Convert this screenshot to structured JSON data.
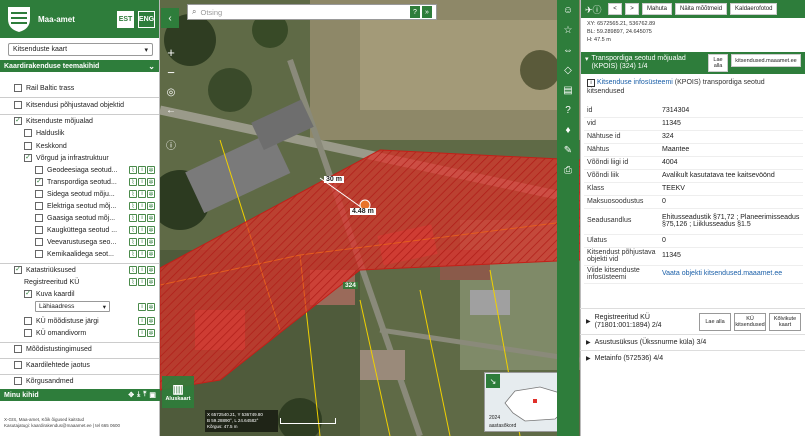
{
  "brand": {
    "name": "Maa-amet",
    "lang_est": "EST",
    "lang_eng": "ENG"
  },
  "map_select": {
    "value": "Kitsenduste kaart"
  },
  "theme_bar": {
    "label": "Kaardirakenduse teemakihid"
  },
  "tree": [
    {
      "label": "Rail Baltic trass",
      "checked": false
    },
    {
      "label": "Kitsendusi põhjustavad objektid",
      "checked": false
    },
    {
      "label": "Kitsenduste mõjualad",
      "checked": true
    },
    {
      "label": "Halduslik",
      "checked": false
    },
    {
      "label": "Keskkond",
      "checked": false
    },
    {
      "label": "Võrgud ja infrastruktuur",
      "checked": true
    },
    {
      "label": "Geodeesiaga seotud...",
      "checked": false
    },
    {
      "label": "Transpordiga seotud...",
      "checked": true
    },
    {
      "label": "Sidega seotud mõju...",
      "checked": false
    },
    {
      "label": "Elektriga seotud mõj...",
      "checked": false
    },
    {
      "label": "Gaasiga seotud mõj...",
      "checked": false
    },
    {
      "label": "Kaugküttega seotud ...",
      "checked": false
    },
    {
      "label": "Veevarustusega seo...",
      "checked": false
    },
    {
      "label": "Kemikaalidega seot...",
      "checked": false
    },
    {
      "label": "Katastriüksused",
      "checked": true
    },
    {
      "label": "Registreeritud KÜ"
    },
    {
      "label": "Kuva kaardil",
      "checked": true
    },
    {
      "label": "Lähiaadress"
    },
    {
      "label": "KÜ mõõdistuse järgi",
      "checked": false
    },
    {
      "label": "KÜ omandivorm",
      "checked": false
    },
    {
      "label": "Mõõdistustingimused",
      "checked": false
    },
    {
      "label": "Kaardilehtede jaotus",
      "checked": false
    },
    {
      "label": "Kõrgusandmed",
      "checked": false
    }
  ],
  "minu_bar": {
    "label": "Minu kihid"
  },
  "footer": {
    "line1": "X-GIS, Maa-amet, Kõik õigused kaitstud",
    "line2": "Kasutajatugi: kaardirakendus@maaamet.ee | tel 665 0600"
  },
  "search": {
    "placeholder": "Otsing"
  },
  "aluskaart": {
    "label": "Aluskaart"
  },
  "map_labels": {
    "distance_30": "30 m",
    "distance_448": "4.48 m",
    "parcel_324": "324",
    "overview_year": "2024",
    "overview_label": "aastasõkord",
    "coord_box_l1": "X 6572540.21, Y 536749.80",
    "coord_box_l2": "B 59.28890°, L 24.64582°",
    "coord_box_l3": "Kõrgus: 47.5 m"
  },
  "right_top": {
    "btn_prev": "<",
    "btn_next": ">",
    "btn_mahuta": "Mahuta",
    "btn_naita": "Näita mõõtmeid",
    "btn_kaldaerofotod": "Kaldaerofotod",
    "coord_xy": "XY: 6572565.21, 536762.89",
    "coord_bl": "BL: 59.289897, 24.645075",
    "coord_h": "H: 47.5 m"
  },
  "feature": {
    "title": "Transpordiga seotud mõjualad (KPOIS) (324) 1/4",
    "btn_lae": "Lae alla",
    "btn_site": "kitsendused.maaamet.ee",
    "desc_link": "Kitsenduse infosüsteemi",
    "desc_rest": "(KPOIS) transpordiga seotud kitsendused"
  },
  "attributes": [
    {
      "key": "id",
      "value": "7314304"
    },
    {
      "key": "vid",
      "value": "11345"
    },
    {
      "key": "Nähtuse id",
      "value": "324"
    },
    {
      "key": "Nähtus",
      "value": "Maantee"
    },
    {
      "key": "Võõndi liigi id",
      "value": "4004"
    },
    {
      "key": "Võõndi liik",
      "value": "Avalikult kasutatava tee kaitsevöönd"
    },
    {
      "key": "Klass",
      "value": "TEEKV"
    },
    {
      "key": "Maksuosoodustus",
      "value": "0"
    },
    {
      "key": "Seadusandlus",
      "value": "Ehitusseadustik §71,72 ; Planeerimisseadus §75,126 ; Liiklusseadus §1.5"
    },
    {
      "key": "Ulatus",
      "value": "0"
    },
    {
      "key": "Kitsendust põhjustava objekti vid",
      "value": "11345"
    },
    {
      "key": "Viide kitsenduste infosüsteemi",
      "value": "Vaata objekti kitsendused.maaamet.ee"
    }
  ],
  "accordion": [
    {
      "label": "Registreeritud KÜ (71801:001:1894) 2/4",
      "btn1": "Lae alla",
      "btn2": "KÜ kitsendused",
      "btn3": "Kõlvikute kaart"
    },
    {
      "label": "Asustusüksus (Ükssnurme küla) 3/4"
    },
    {
      "label": "Metainfo (572536) 4/4"
    }
  ],
  "colors": {
    "brand_green": "#2e7d3b",
    "zone_red": "#e0302a",
    "link_blue": "#1a5fa8"
  }
}
